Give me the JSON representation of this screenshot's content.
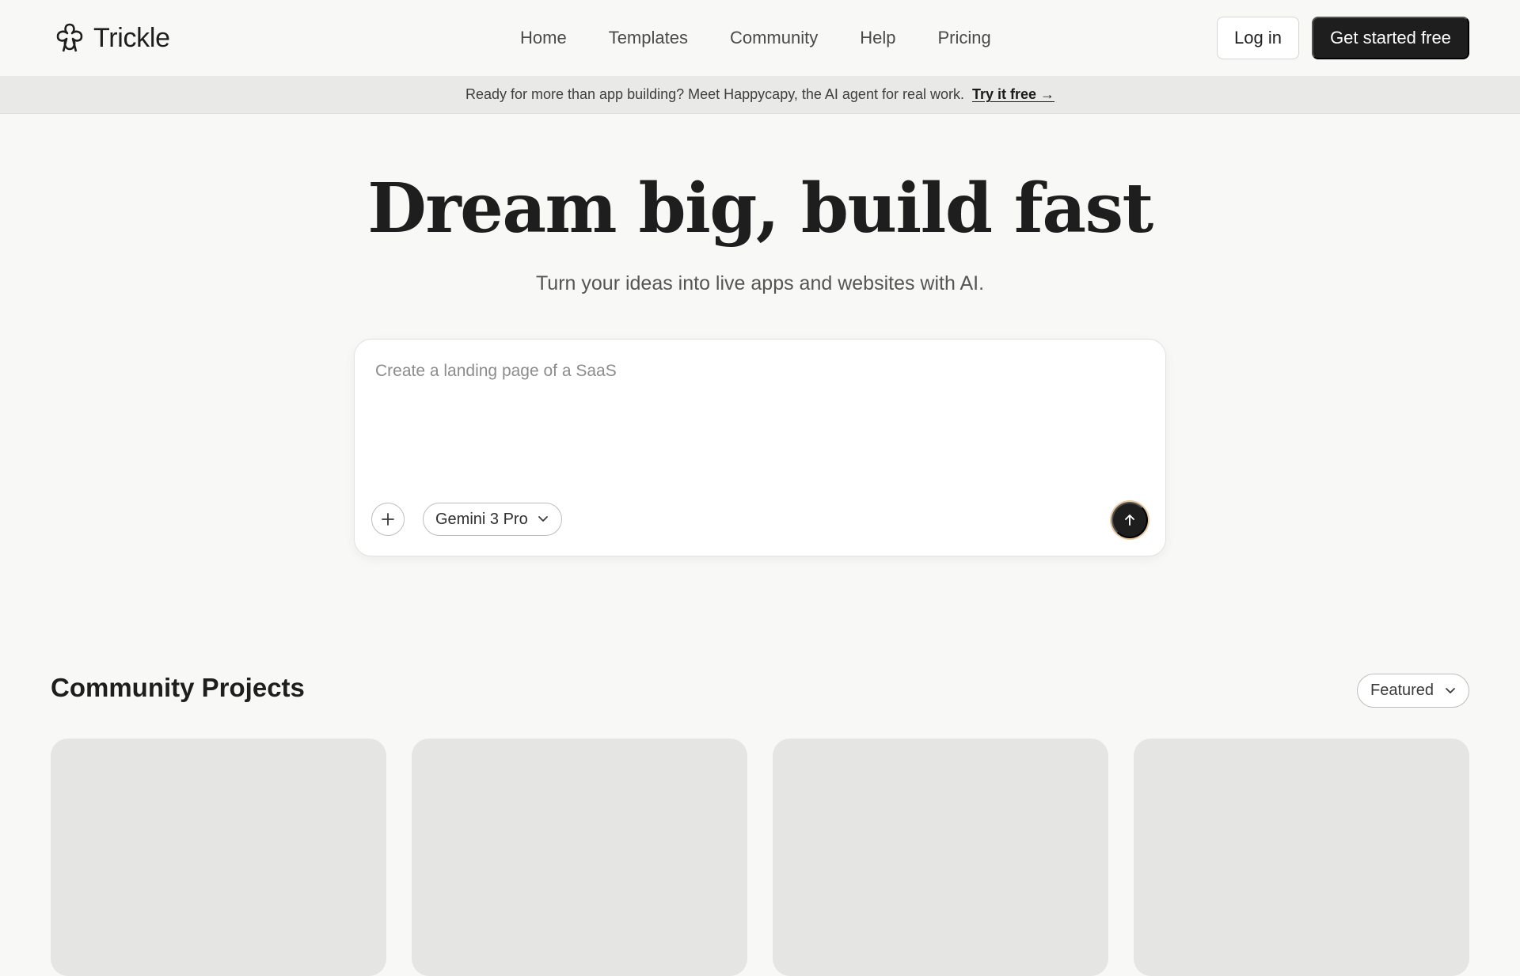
{
  "header": {
    "logo_text": "Trickle",
    "nav": [
      "Home",
      "Templates",
      "Community",
      "Help",
      "Pricing"
    ],
    "login_label": "Log in",
    "cta_label": "Get started free"
  },
  "banner": {
    "text": "Ready for more than app building? Meet Happycapy, the AI agent for real work.",
    "link_label": "Try it free →"
  },
  "hero": {
    "title": "Dream big, build fast",
    "subtitle": "Turn your ideas into live apps and websites with AI."
  },
  "prompt": {
    "placeholder": "Create a landing page of a SaaS",
    "value": "",
    "model": "Gemini 3 Pro"
  },
  "community": {
    "title": "Community Projects",
    "sort": "Featured",
    "cards": [
      {},
      {},
      {},
      {}
    ]
  },
  "icons": {
    "logo": "flower-logo-icon",
    "add": "plus-icon",
    "model_dropdown": "chevron-down-icon",
    "send": "arrow-up-icon",
    "sort_dropdown": "chevron-down-icon"
  },
  "colors": {
    "background": "#f8f8f7",
    "primary_button": "#1e1e1e",
    "banner_background": "#e9e9e8",
    "card_placeholder": "#e5e5e4",
    "send_button_ring": "#e9c9a0"
  }
}
